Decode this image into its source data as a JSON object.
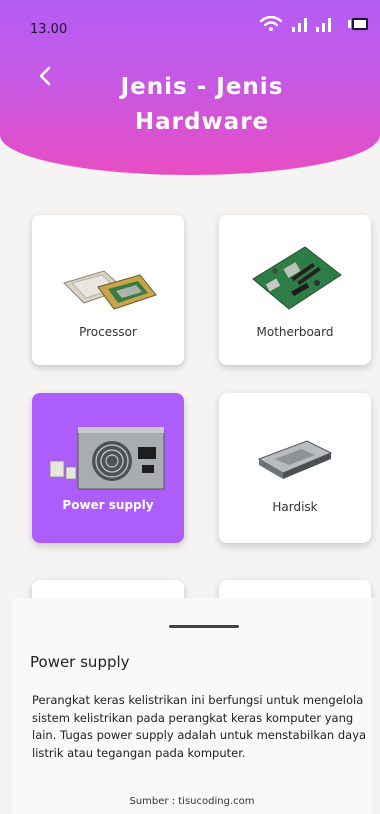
{
  "status_bar": {
    "time": "13.00"
  },
  "header": {
    "title_line1": "Jenis - Jenis",
    "title_line2": "Hardware",
    "back_icon": "chevron-left-icon"
  },
  "cards": [
    {
      "label": "Processor",
      "selected": false
    },
    {
      "label": "Motherboard",
      "selected": false
    },
    {
      "label": "Power supply",
      "selected": true
    },
    {
      "label": "Hardisk",
      "selected": false
    }
  ],
  "detail": {
    "title": "Power supply",
    "description": "Perangkat keras kelistrikan ini berfungsi untuk mengelola sistem kelistrikan pada perangkat keras komputer yang lain. Tugas power supply adalah untuk menstabilkan  daya listrik atau tegangan pada komputer.",
    "source": "Sumber : tisucoding.com"
  },
  "colors": {
    "accent": "#ad5dfb",
    "header_top": "#b45df5",
    "header_bottom": "#e74dc3"
  }
}
